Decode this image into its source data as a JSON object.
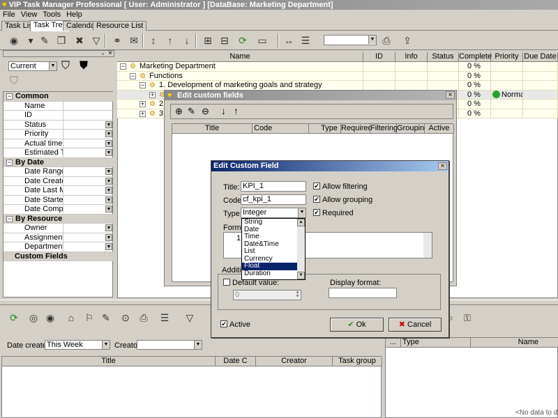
{
  "app": {
    "title": "VIP Task Manager Professional [ User: Administrator ] [DataBase: Marketing Department]"
  },
  "menu": [
    "File",
    "View",
    "Tools",
    "Help"
  ],
  "tabs": [
    "Task List",
    "Task Tree",
    "Calendar",
    "Resource List"
  ],
  "left_panel": {
    "filter_value": "Current",
    "categories": [
      {
        "name": "Common",
        "items": [
          "Name",
          "ID",
          "Status",
          "Priority",
          "Actual time",
          "Estimated Tim"
        ]
      },
      {
        "name": "By Date",
        "items": [
          "Date Range",
          "Date Created",
          "Date Last Mo",
          "Date Started",
          "Date Complet"
        ]
      },
      {
        "name": "By Resource",
        "items": [
          "Owner",
          "Assignment",
          "Department"
        ]
      },
      {
        "name": "Custom Fields",
        "items": []
      }
    ]
  },
  "grid": {
    "columns": [
      "Name",
      "ID",
      "Info",
      "Status",
      "Complete",
      "Priority",
      "Due Date"
    ],
    "rows": [
      {
        "name": "Marketing Department",
        "complete": "0 %",
        "priority": ""
      },
      {
        "name": "Functions",
        "complete": "0 %",
        "priority": ""
      },
      {
        "name": "1. Development of marketing goals and strategy",
        "complete": "0 %",
        "priority": ""
      },
      {
        "name": "",
        "complete": "0 %",
        "priority": "Norma"
      },
      {
        "name": "2.",
        "complete": "0 %",
        "priority": ""
      },
      {
        "name": "3.",
        "complete": "0 %",
        "priority": ""
      }
    ]
  },
  "custom_fields_window": {
    "title": "Edit custom fields",
    "columns": [
      "Title",
      "Code",
      "Type",
      "Required",
      "Filtering",
      "Grouping",
      "Active"
    ]
  },
  "edit_dialog": {
    "title": "Edit Custom Field",
    "title_label": "Title:",
    "title_value": "KPI_1",
    "code_label": "Code:",
    "code_value": "cf_kpi_1",
    "type_label": "Type:",
    "type_value": "Integer",
    "formula_label": "Formula",
    "formula_line": "1",
    "additional_label": "Addition",
    "allow_filtering": "Allow filtering",
    "allow_grouping": "Allow grouping",
    "required": "Required",
    "default_value_label": "Default value:",
    "default_value": "0",
    "display_format_label": "Display format:",
    "display_format": "",
    "active_label": "Active",
    "ok": "Ok",
    "cancel": "Cancel",
    "type_options": [
      "String",
      "Date",
      "Time",
      "Date&Time",
      "List",
      "Currency",
      "Float",
      "Duration"
    ],
    "selected_option": "Float"
  },
  "bottom": {
    "date_created_label": "Date created:",
    "date_created_value": "This Week",
    "creator_label": "Creator:",
    "creator_value": "",
    "columns": [
      "Title",
      "Date C",
      "Creator",
      "Task group"
    ],
    "right_columns": [
      "...",
      "Type",
      "Name"
    ],
    "no_data": "<No data to displ"
  },
  "colors": {
    "accent": "#0a246a",
    "grid_yellow": "#fffff0"
  }
}
